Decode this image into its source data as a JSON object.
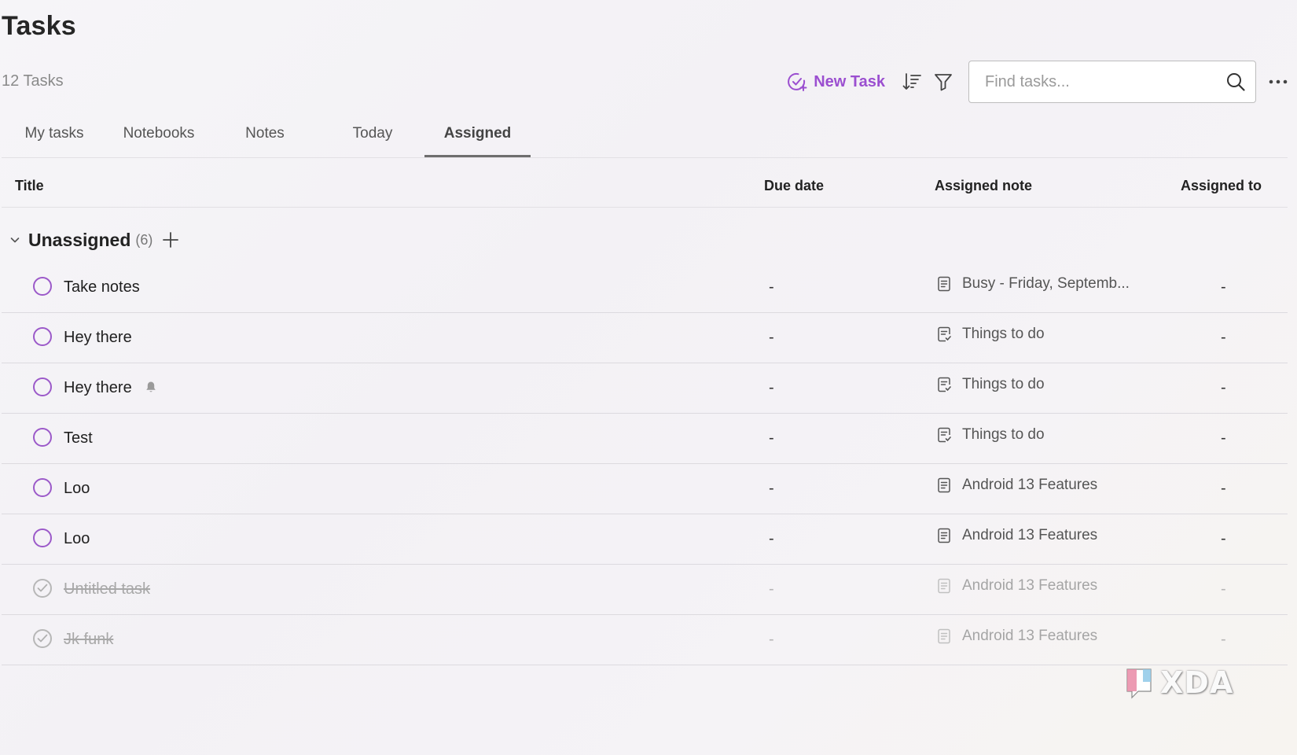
{
  "page": {
    "title": "Tasks",
    "task_count": "12 Tasks"
  },
  "toolbar": {
    "new_task_label": "New Task",
    "sort_icon": "sort-icon",
    "filter_icon": "filter-icon",
    "search_placeholder": "Find tasks...",
    "more_icon": "more-horizontal-icon"
  },
  "tabs": [
    {
      "label": "My tasks",
      "active": false
    },
    {
      "label": "Notebooks",
      "active": false
    },
    {
      "label": "Notes",
      "active": false
    },
    {
      "label": "Today",
      "active": false
    },
    {
      "label": "Assigned",
      "active": true
    }
  ],
  "columns": {
    "title": "Title",
    "due_date": "Due date",
    "assigned_note": "Assigned note",
    "assigned_to": "Assigned to"
  },
  "group": {
    "name": "Unassigned",
    "count": "(6)"
  },
  "tasks": [
    {
      "title": "Take notes",
      "due": "-",
      "note": "Busy - Friday, Septemb...",
      "note_icon": "note-icon",
      "assignee": "-",
      "done": false,
      "reminder": false
    },
    {
      "title": "Hey there",
      "due": "-",
      "note": "Things to do",
      "note_icon": "task-list-icon",
      "assignee": "-",
      "done": false,
      "reminder": false
    },
    {
      "title": "Hey there",
      "due": "-",
      "note": "Things to do",
      "note_icon": "task-list-icon",
      "assignee": "-",
      "done": false,
      "reminder": true
    },
    {
      "title": "Test",
      "due": "-",
      "note": "Things to do",
      "note_icon": "task-list-icon",
      "assignee": "-",
      "done": false,
      "reminder": false
    },
    {
      "title": "Loo",
      "due": "-",
      "note": "Android 13 Features",
      "note_icon": "note-icon",
      "assignee": "-",
      "done": false,
      "reminder": false
    },
    {
      "title": "Loo",
      "due": "-",
      "note": "Android 13 Features",
      "note_icon": "note-icon",
      "assignee": "-",
      "done": false,
      "reminder": false
    },
    {
      "title": "Untitled task",
      "due": "-",
      "note": "Android 13 Features",
      "note_icon": "note-icon",
      "assignee": "-",
      "done": true,
      "reminder": false
    },
    {
      "title": "Jk funk",
      "due": "-",
      "note": "Android 13 Features",
      "note_icon": "note-icon",
      "assignee": "-",
      "done": true,
      "reminder": false
    }
  ],
  "watermark": {
    "text": "XDA"
  },
  "colors": {
    "accent": "#9b4fd0",
    "checkbox": "#9b59c9",
    "done_text": "#a8a8a8"
  }
}
